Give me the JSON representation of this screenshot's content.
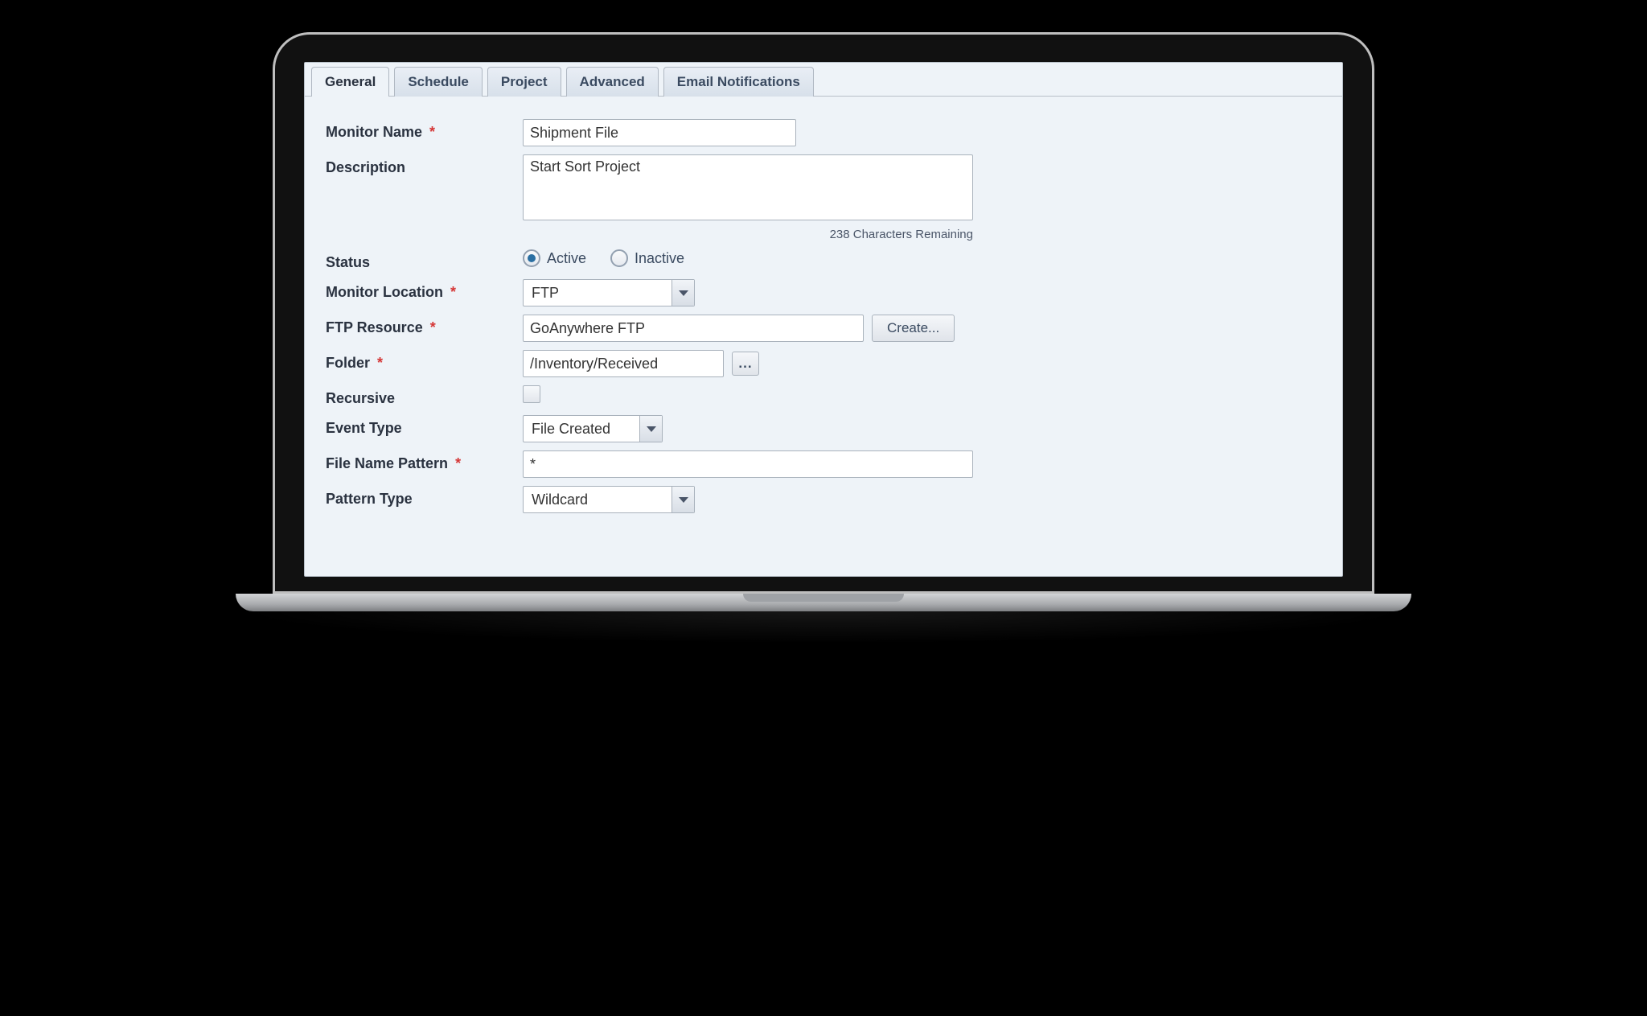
{
  "tabs": [
    {
      "label": "General"
    },
    {
      "label": "Schedule"
    },
    {
      "label": "Project"
    },
    {
      "label": "Advanced"
    },
    {
      "label": "Email Notifications"
    }
  ],
  "form": {
    "monitor_name_label": "Monitor Name",
    "monitor_name_value": "Shipment File",
    "description_label": "Description",
    "description_value": "Start Sort Project",
    "description_remaining": "238 Characters Remaining",
    "status_label": "Status",
    "status_active_label": "Active",
    "status_inactive_label": "Inactive",
    "monitor_location_label": "Monitor Location",
    "monitor_location_value": "FTP",
    "ftp_resource_label": "FTP Resource",
    "ftp_resource_value": "GoAnywhere FTP",
    "create_button_label": "Create...",
    "folder_label": "Folder",
    "folder_value": "/Inventory/Received",
    "browse_button_label": "...",
    "recursive_label": "Recursive",
    "event_type_label": "Event Type",
    "event_type_value": "File Created",
    "file_name_pattern_label": "File Name Pattern",
    "file_name_pattern_value": "*",
    "pattern_type_label": "Pattern Type",
    "pattern_type_value": "Wildcard",
    "required_marker": "*"
  }
}
